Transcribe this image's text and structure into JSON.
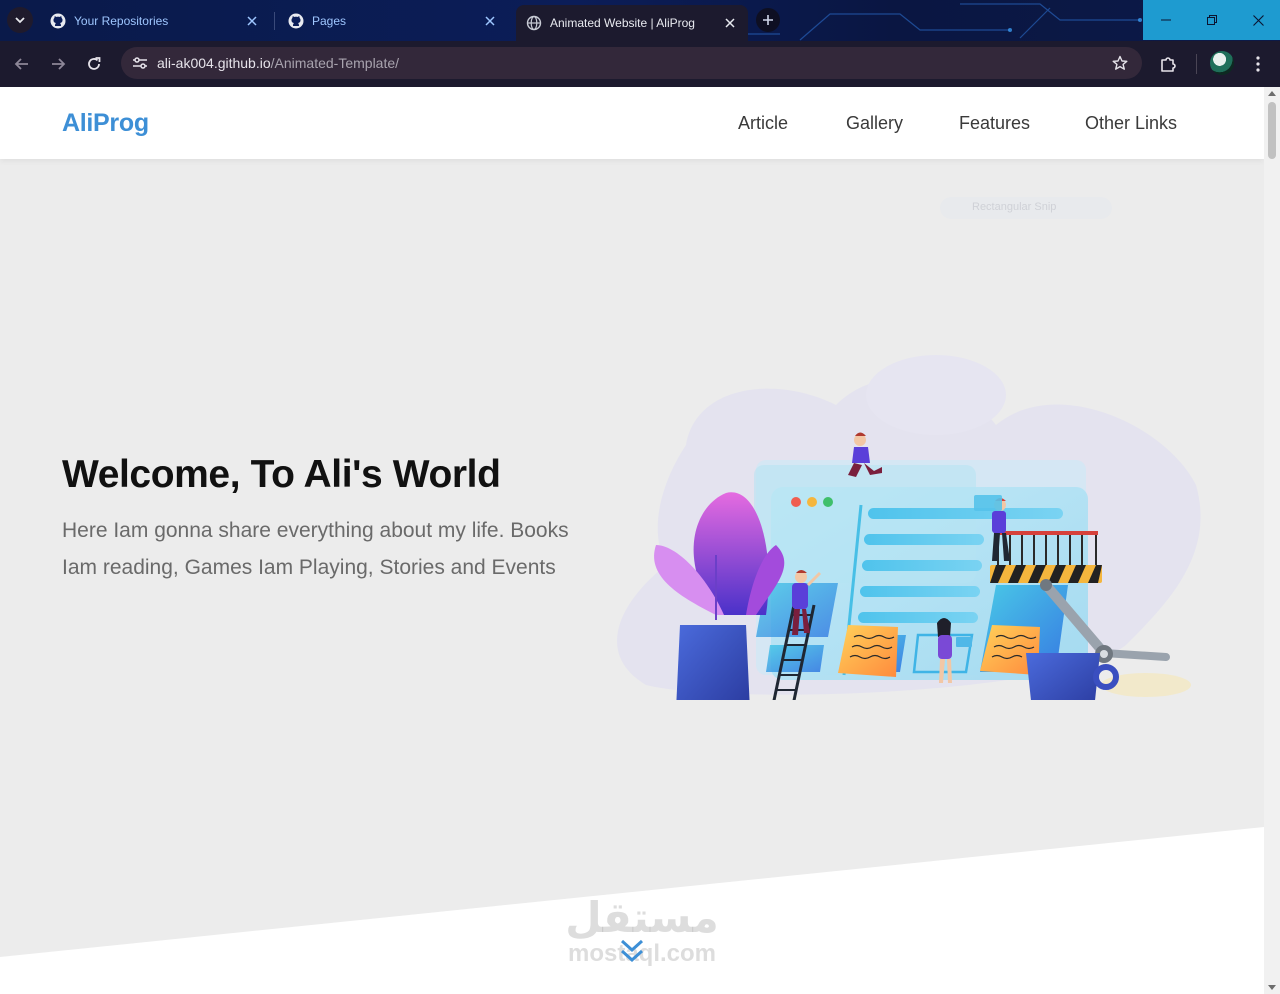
{
  "browser": {
    "tabs": [
      {
        "title": "Your Repositories",
        "active": false,
        "icon": "github-icon"
      },
      {
        "title": "Pages",
        "active": false,
        "icon": "github-icon"
      },
      {
        "title": "Animated Website | AliProg",
        "active": true,
        "icon": "globe-icon"
      }
    ],
    "address": {
      "host": "ali-ak004.github.io",
      "path": "/Animated-Template/"
    }
  },
  "site": {
    "logo": "AliProg",
    "nav": [
      "Article",
      "Gallery",
      "Features",
      "Other Links"
    ],
    "hero": {
      "title": "Welcome, To Ali's World",
      "text": "Here Iam gonna share everything about my life. Books Iam reading, Games Iam Playing, Stories and Events"
    },
    "ghost_label": "Rectangular Snip"
  },
  "watermark": {
    "arabic": "مستقل",
    "latin": "mostaql.com"
  },
  "colors": {
    "accent": "#3d8fd6",
    "page_bg": "#ececec",
    "titlebar": "#0b1d58",
    "window_controls": "#1e9bd0"
  }
}
